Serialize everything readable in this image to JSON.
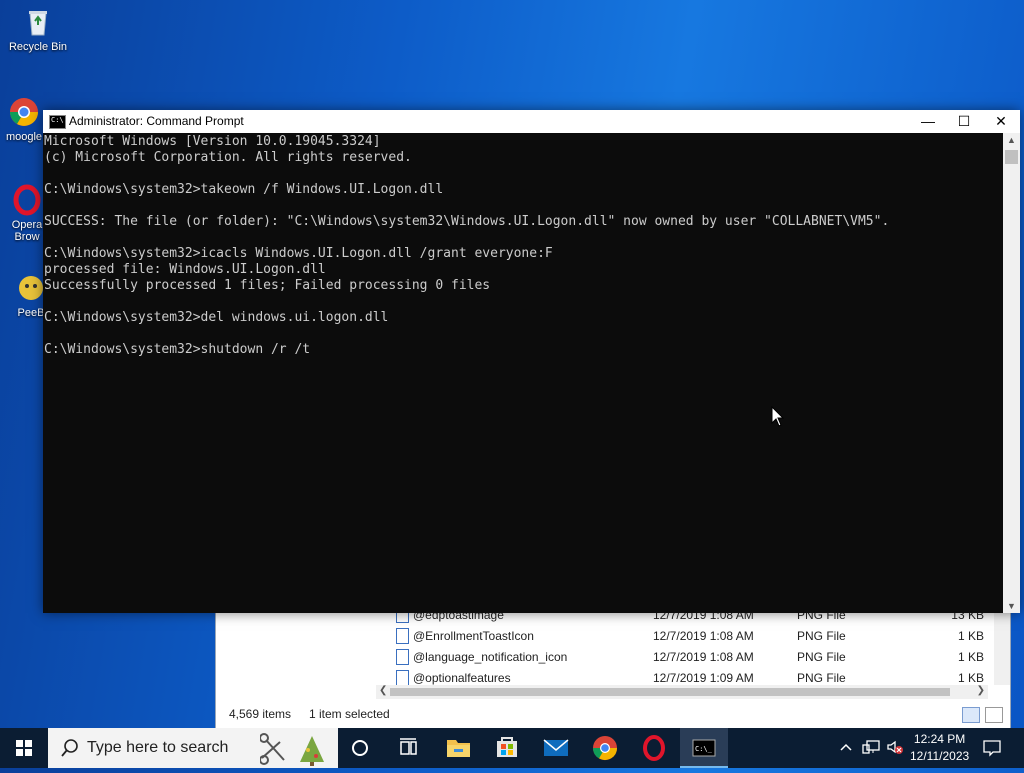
{
  "desktop": {
    "icons": [
      {
        "label": "Recycle Bin",
        "icon": "recycle-bin-icon"
      },
      {
        "label": "moogle",
        "icon": "chrome-icon"
      },
      {
        "label": "Opera\nBrow",
        "icon": "opera-icon"
      },
      {
        "label": "PeeB",
        "icon": "app-icon"
      }
    ]
  },
  "cmd": {
    "title": "Administrator: Command Prompt",
    "lines": [
      "Microsoft Windows [Version 10.0.19045.3324]",
      "(c) Microsoft Corporation. All rights reserved.",
      "",
      "C:\\Windows\\system32>takeown /f Windows.UI.Logon.dll",
      "",
      "SUCCESS: The file (or folder): \"C:\\Windows\\system32\\Windows.UI.Logon.dll\" now owned by user \"COLLABNET\\VM5\".",
      "",
      "C:\\Windows\\system32>icacls Windows.UI.Logon.dll /grant everyone:F",
      "processed file: Windows.UI.Logon.dll",
      "Successfully processed 1 files; Failed processing 0 files",
      "",
      "C:\\Windows\\system32>del windows.ui.logon.dll",
      "",
      "C:\\Windows\\system32>shutdown /r /t"
    ],
    "controls": {
      "minimize": "—",
      "maximize": "☐",
      "close": "✕"
    }
  },
  "explorer": {
    "rows": [
      {
        "name": "@edptoastimage",
        "date": "12/7/2019 1:08 AM",
        "type": "PNG File",
        "size": "13 KB"
      },
      {
        "name": "@EnrollmentToastIcon",
        "date": "12/7/2019 1:08 AM",
        "type": "PNG File",
        "size": "1 KB"
      },
      {
        "name": "@language_notification_icon",
        "date": "12/7/2019 1:08 AM",
        "type": "PNG File",
        "size": "1 KB"
      },
      {
        "name": "@optionalfeatures",
        "date": "12/7/2019 1:09 AM",
        "type": "PNG File",
        "size": "1 KB"
      }
    ],
    "status": {
      "items": "4,569 items",
      "selected": "1 item selected"
    }
  },
  "taskbar": {
    "search_placeholder": "Type here to search",
    "apps": [
      "cortana-icon",
      "task-view-icon",
      "file-explorer-icon",
      "store-icon",
      "mail-icon",
      "chrome-icon",
      "opera-icon",
      "command-prompt-icon"
    ],
    "clock": {
      "time": "12:24 PM",
      "date": "12/11/2023"
    }
  },
  "colors": {
    "console_bg": "#0c0c0c",
    "console_fg": "#cccccc",
    "taskbar": "#0b1d33"
  }
}
